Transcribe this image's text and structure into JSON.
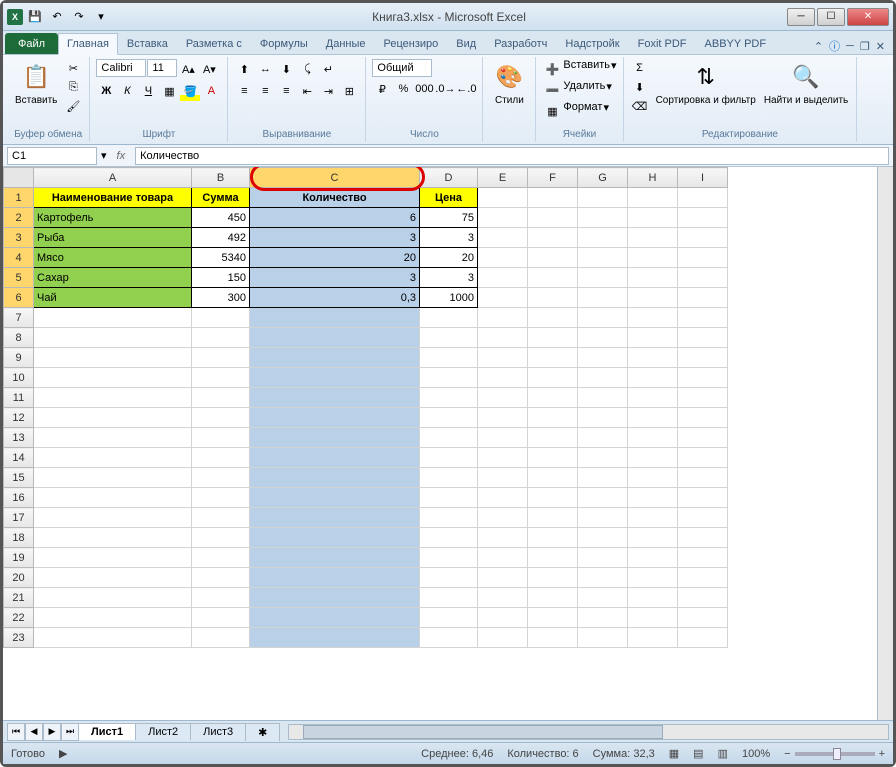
{
  "title": "Книга3.xlsx  -  Microsoft Excel",
  "tabs": {
    "file": "Файл",
    "home": "Главная",
    "insert": "Вставка",
    "layout": "Разметка с",
    "formulas": "Формулы",
    "data": "Данные",
    "review": "Рецензиро",
    "view": "Вид",
    "developer": "Разработч",
    "addins": "Надстройк",
    "foxit": "Foxit PDF",
    "abbyy": "ABBYY PDF"
  },
  "ribbon": {
    "clipboard": {
      "paste": "Вставить",
      "label": "Буфер обмена"
    },
    "font": {
      "name": "Calibri",
      "size": "11",
      "label": "Шрифт"
    },
    "alignment": {
      "label": "Выравнивание"
    },
    "number": {
      "format": "Общий",
      "label": "Число"
    },
    "styles": {
      "btn": "Стили"
    },
    "cells": {
      "insert": "Вставить",
      "delete": "Удалить",
      "format": "Формат",
      "label": "Ячейки"
    },
    "editing": {
      "sort": "Сортировка и фильтр",
      "find": "Найти и выделить",
      "label": "Редактирование"
    }
  },
  "namebox": "C1",
  "formula": "Количество",
  "columns": [
    "A",
    "B",
    "C",
    "D",
    "E",
    "F",
    "G",
    "H",
    "I"
  ],
  "headers": {
    "a": "Наименование товара",
    "b": "Сумма",
    "c": "Количество",
    "d": "Цена"
  },
  "rows": [
    {
      "a": "Картофель",
      "b": "450",
      "c": "6",
      "d": "75"
    },
    {
      "a": "Рыба",
      "b": "492",
      "c": "3",
      "d": "3"
    },
    {
      "a": "Мясо",
      "b": "5340",
      "c": "20",
      "d": "20"
    },
    {
      "a": "Сахар",
      "b": "150",
      "c": "3",
      "d": "3"
    },
    {
      "a": "Чай",
      "b": "300",
      "c": "0,3",
      "d": "1000"
    }
  ],
  "sheets": {
    "s1": "Лист1",
    "s2": "Лист2",
    "s3": "Лист3"
  },
  "status": {
    "ready": "Готово",
    "avg": "Среднее: 6,46",
    "count": "Количество: 6",
    "sum": "Сумма: 32,3",
    "zoom": "100%"
  },
  "colwidths": {
    "A": 158,
    "B": 58,
    "C": 170,
    "D": 58,
    "other": 50
  }
}
